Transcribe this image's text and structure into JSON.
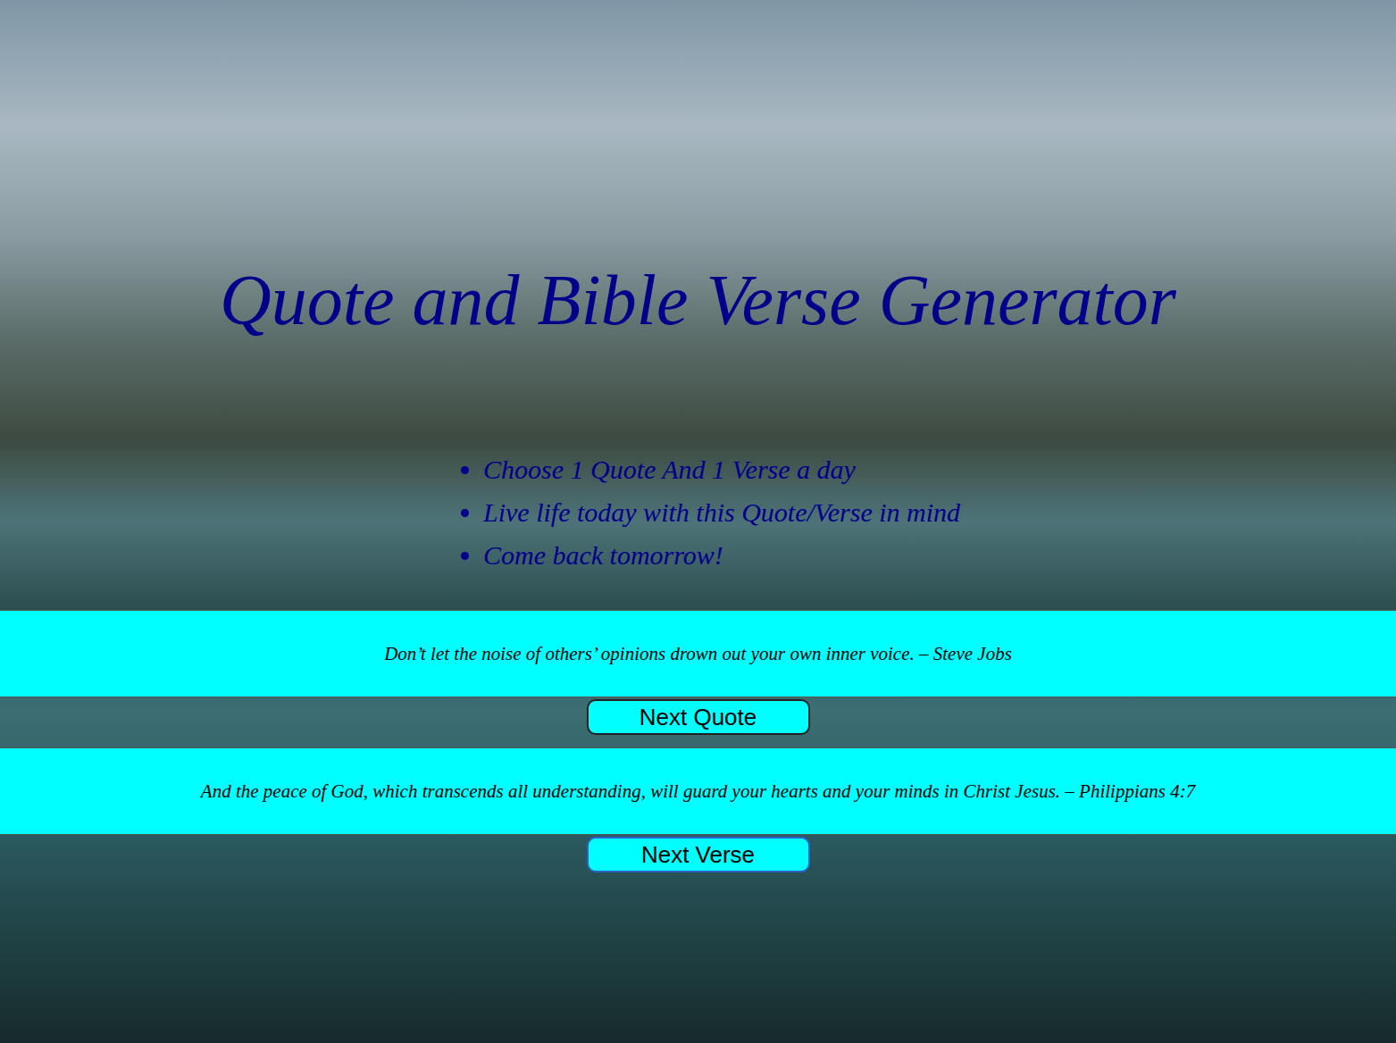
{
  "page": {
    "title": "Quote and Bible Verse Generator"
  },
  "instructions": [
    "Choose 1 Quote And 1 Verse a day",
    "Live life today with this Quote/Verse in mind",
    "Come back tomorrow!"
  ],
  "quote": {
    "text": "Don’t let the noise of others’ opinions drown out your own inner voice. – Steve Jobs",
    "button": "Next Quote"
  },
  "verse": {
    "text": "And the peace of God, which transcends all understanding, will guard your hearts and your minds in Christ Jesus. – Philippians 4:7",
    "button": "Next Verse"
  }
}
